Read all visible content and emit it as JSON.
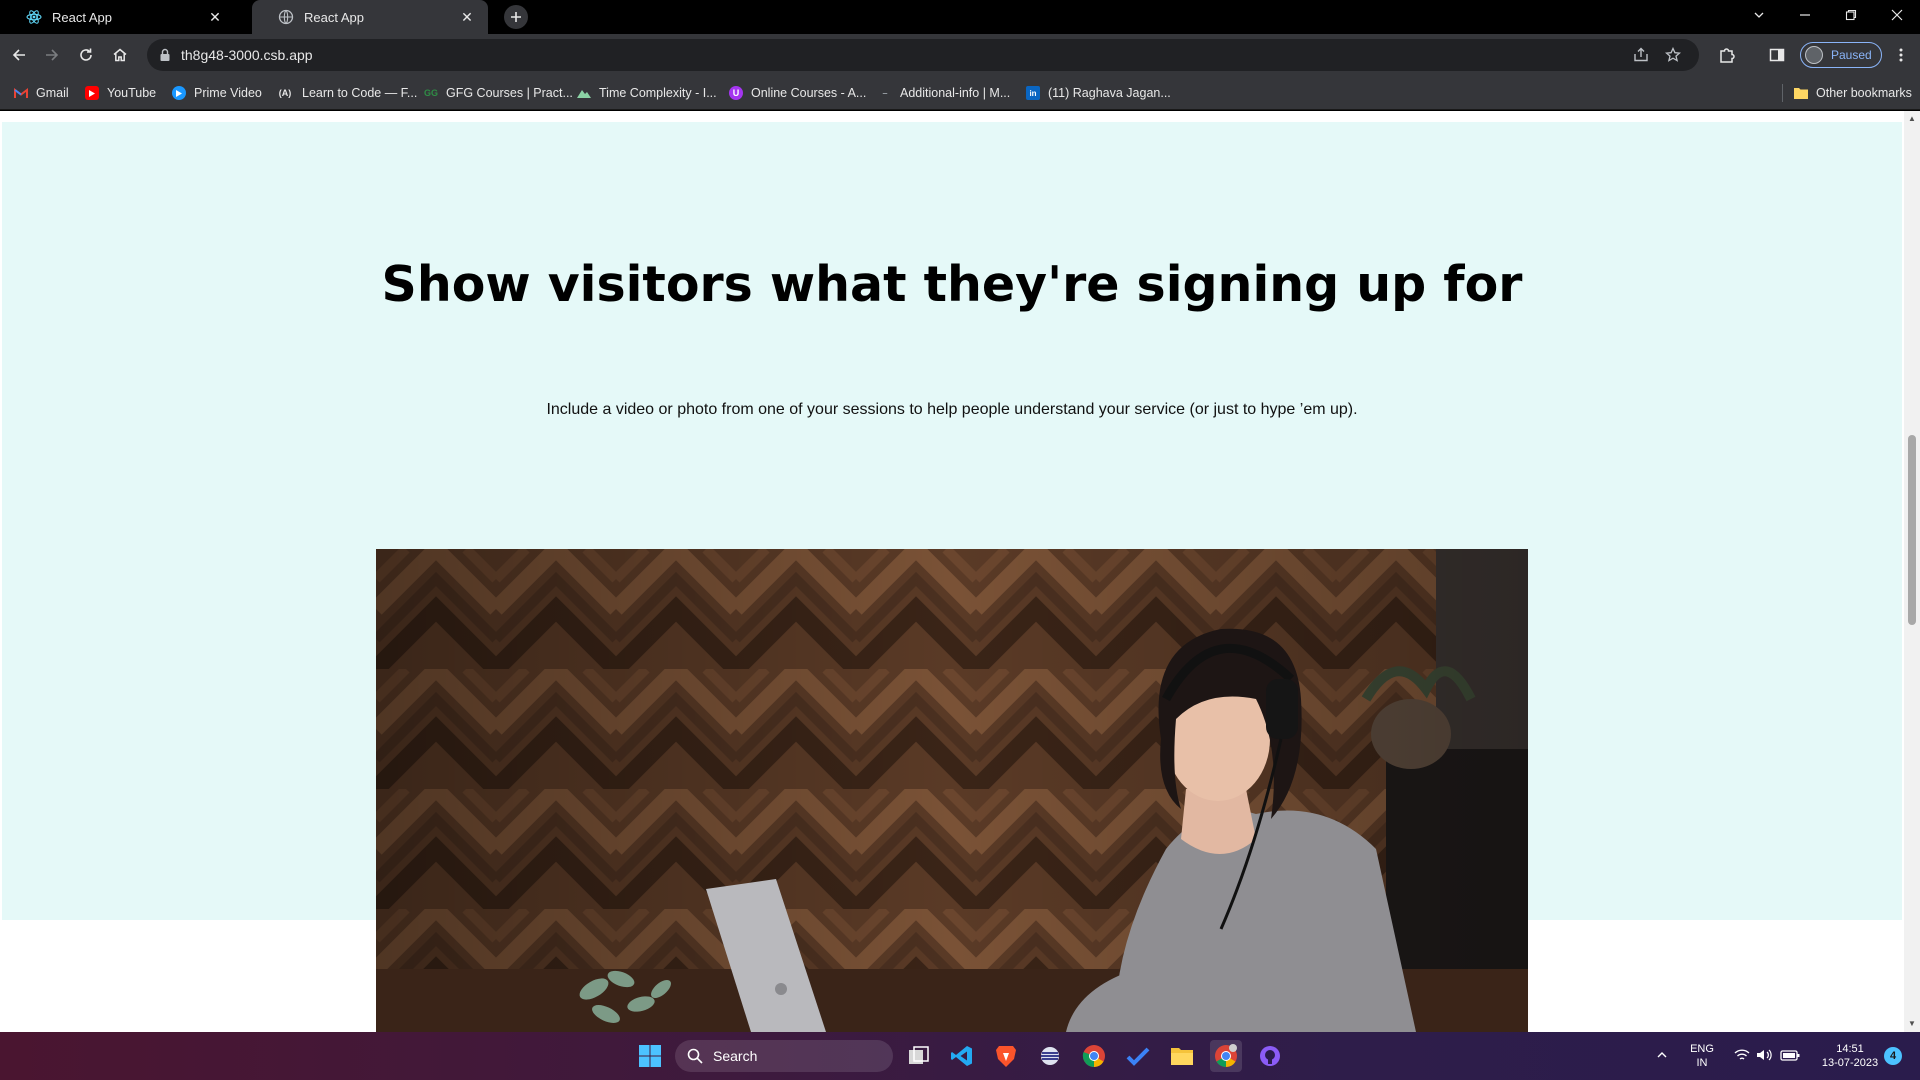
{
  "browser": {
    "tabs": [
      {
        "title": "React App",
        "active": false
      },
      {
        "title": "React App",
        "active": true
      }
    ],
    "url": "th8g48-3000.csb.app",
    "profile_label": "Paused",
    "bookmarks": [
      {
        "label": "Gmail",
        "icon": "gmail-icon"
      },
      {
        "label": "YouTube",
        "icon": "youtube-icon"
      },
      {
        "label": "Prime Video",
        "icon": "prime-video-icon"
      },
      {
        "label": "Learn to Code — F...",
        "icon": "freecodecamp-icon"
      },
      {
        "label": "GFG Courses | Pract...",
        "icon": "gfg-icon"
      },
      {
        "label": "Time Complexity - I...",
        "icon": "mountain-icon"
      },
      {
        "label": "Online Courses - A...",
        "icon": "online-courses-icon"
      },
      {
        "label": "Additional-info | M...",
        "icon": "dash-icon"
      },
      {
        "label": "(11) Raghava Jagan...",
        "icon": "linkedin-icon"
      }
    ],
    "other_bookmarks": "Other bookmarks"
  },
  "page": {
    "hero_title": "Show visitors what they're signing up for",
    "hero_subtitle": "Include a video or photo from one of your sessions to help people understand your service (or just to hype ’em up).",
    "colors": {
      "hero_bg": "#e5f9f8",
      "page_bg": "#ffffff"
    }
  },
  "taskbar": {
    "search_placeholder": "Search",
    "lang_top": "ENG",
    "lang_bottom": "IN",
    "time": "14:51",
    "date": "13-07-2023",
    "notification_count": "4"
  }
}
